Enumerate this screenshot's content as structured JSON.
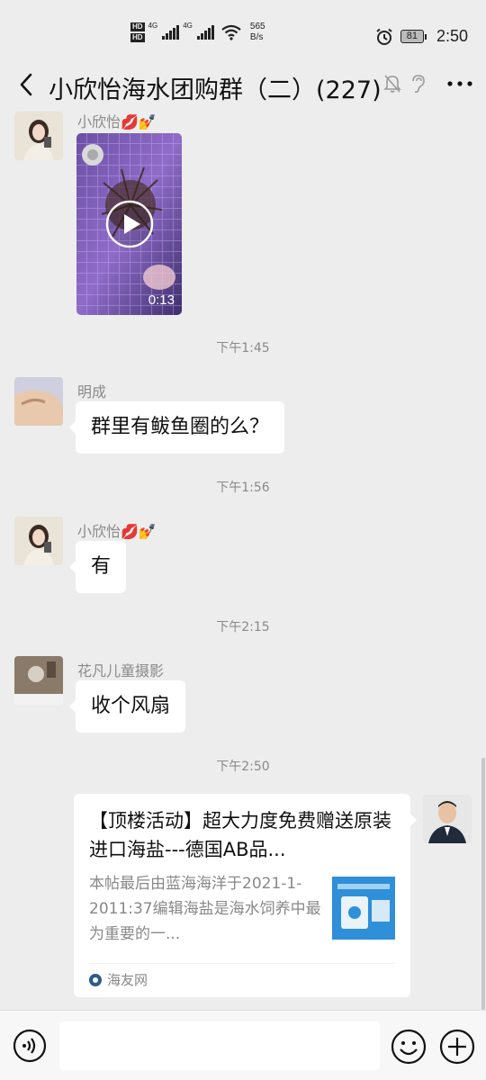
{
  "status_bar": {
    "hd1": "HD",
    "hd2": "HD",
    "network1": "4G",
    "network2": "4G",
    "speed_value": "565",
    "speed_unit": "B/s",
    "battery": "81",
    "time": "2:50",
    "icons": [
      "alarm-icon",
      "wifi-icon",
      "signal-icon",
      "battery-icon"
    ]
  },
  "header": {
    "title": "小欣怡海水团购群（二）(227)",
    "icons": [
      "back-icon",
      "mute-bell-icon",
      "ear-icon",
      "more-icon"
    ]
  },
  "messages": [
    {
      "type": "video",
      "sender": "小欣怡💋💅",
      "duration": "0:13"
    },
    {
      "type": "time",
      "text": "下午1:45"
    },
    {
      "type": "text",
      "sender": "明成",
      "text": "群里有鲅鱼圈的么？"
    },
    {
      "type": "time",
      "text": "下午1:56"
    },
    {
      "type": "text",
      "sender": "小欣怡💋💅",
      "text": "有"
    },
    {
      "type": "time",
      "text": "下午2:15"
    },
    {
      "type": "text",
      "sender": "花凡儿童摄影",
      "text": "收个风扇"
    },
    {
      "type": "time",
      "text": "下午2:50"
    },
    {
      "type": "link_card",
      "title": "【顶楼活动】超大力度免费赠送原装进口海盐---德国AB品...",
      "description": "本帖最后由蓝海海洋于2021-1-2011:37编辑海盐是海水饲养中最为重要的一...",
      "source": "海友网"
    }
  ],
  "input_bar": {
    "placeholder": "",
    "icons": [
      "voice-icon",
      "emoji-icon",
      "plus-icon"
    ]
  },
  "colors": {
    "background": "#ededed",
    "bubble": "#ffffff",
    "timestamp": "#8a8a8a"
  }
}
